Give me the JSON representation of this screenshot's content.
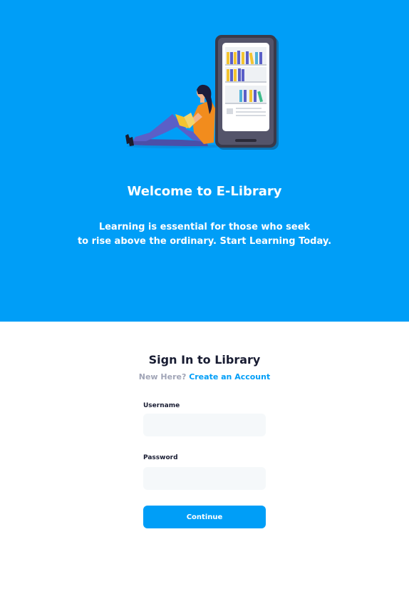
{
  "hero": {
    "title": "Welcome to E-Library",
    "subtitle_line1": "Learning is essential for those who seek",
    "subtitle_line2": "to rise above the ordinary. Start Learning Today.",
    "illustration": "woman-reading-beside-phone-bookshelf",
    "background_color": "#009ef7"
  },
  "signin": {
    "title": "Sign In to Library",
    "new_here": "New Here?",
    "create_account": "Create an Account",
    "username_label": "Username",
    "username_value": "",
    "password_label": "Password",
    "password_value": "",
    "continue_label": "Continue"
  },
  "colors": {
    "primary": "#009ef7",
    "input_bg": "#f5f8fa",
    "text_dark": "#181c32",
    "text_muted": "#a1a5b7"
  }
}
